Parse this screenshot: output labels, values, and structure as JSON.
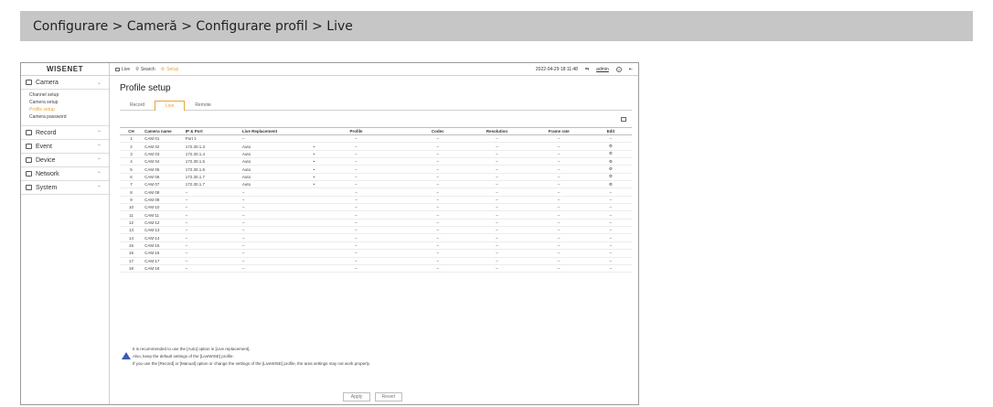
{
  "breadcrumb": "Configurare > Cameră > Configurare profil > Live",
  "topbar": {
    "logo": "WISENET",
    "nav": [
      {
        "label": "Live",
        "icon": "monitor-icon"
      },
      {
        "label": "Search",
        "icon": "search-icon"
      },
      {
        "label": "Setup",
        "icon": "gear-icon"
      }
    ],
    "datetime": "2022-04-29 18:11:48",
    "user": "admin",
    "icons": [
      "network-icon",
      "help-icon",
      "logout-icon"
    ]
  },
  "sidebar": {
    "camera_label": "Camera",
    "camera_items": [
      "Channel setup",
      "Camera setup",
      "Profile setup",
      "Camera password"
    ],
    "active_item": "Profile setup",
    "sections": [
      "Record",
      "Event",
      "Device",
      "Network",
      "System"
    ]
  },
  "main": {
    "title": "Profile setup",
    "tabs": [
      "Record",
      "Live",
      "Remote"
    ],
    "active_tab": "Live",
    "columns": [
      "CH",
      "Camera name",
      "IP & Port",
      "Live Replacement",
      "",
      "Profile",
      "",
      "Codec",
      "Resolution",
      "Frame rate",
      "Edit"
    ],
    "rows": [
      [
        "1",
        "CAM 01",
        "Port 1",
        "–",
        "",
        "–",
        "",
        "–",
        "–",
        "–",
        "–"
      ],
      [
        "2",
        "CAM 02",
        "172.30.1.3",
        "Auto",
        "•",
        "–",
        "",
        "–",
        "–",
        "–",
        "⚙"
      ],
      [
        "3",
        "CAM 03",
        "172.30.1.4",
        "Auto",
        "•",
        "–",
        "",
        "–",
        "–",
        "–",
        "⚙"
      ],
      [
        "4",
        "CAM 04",
        "172.30.1.5",
        "Auto",
        "•",
        "–",
        "",
        "–",
        "–",
        "–",
        "⚙"
      ],
      [
        "5",
        "CAM 05",
        "172.30.1.6",
        "Auto",
        "•",
        "–",
        "",
        "–",
        "–",
        "–",
        "⚙"
      ],
      [
        "6",
        "CAM 06",
        "172.30.1.7",
        "Auto",
        "•",
        "–",
        "",
        "–",
        "–",
        "–",
        "⚙"
      ],
      [
        "7",
        "CAM 07",
        "172.30.1.7",
        "Auto",
        "•",
        "–",
        "",
        "–",
        "–",
        "–",
        "⚙"
      ],
      [
        "8",
        "CAM 08",
        "–",
        "–",
        "",
        "–",
        "",
        "–",
        "–",
        "–",
        "–"
      ],
      [
        "9",
        "CAM 09",
        "–",
        "–",
        "",
        "–",
        "",
        "–",
        "–",
        "–",
        "–"
      ],
      [
        "10",
        "CAM 10",
        "–",
        "–",
        "",
        "–",
        "",
        "–",
        "–",
        "–",
        "–"
      ],
      [
        "11",
        "CAM 11",
        "–",
        "–",
        "",
        "–",
        "",
        "–",
        "–",
        "–",
        "–"
      ],
      [
        "12",
        "CAM 12",
        "–",
        "–",
        "",
        "–",
        "",
        "–",
        "–",
        "–",
        "–"
      ],
      [
        "13",
        "CAM 13",
        "–",
        "–",
        "",
        "–",
        "",
        "–",
        "–",
        "–",
        "–"
      ],
      [
        "14",
        "CAM 14",
        "–",
        "–",
        "",
        "–",
        "",
        "–",
        "–",
        "–",
        "–"
      ],
      [
        "15",
        "CAM 15",
        "–",
        "–",
        "",
        "–",
        "",
        "–",
        "–",
        "–",
        "–"
      ],
      [
        "16",
        "CAM 16",
        "–",
        "–",
        "",
        "–",
        "",
        "–",
        "–",
        "–",
        "–"
      ],
      [
        "17",
        "CAM 17",
        "–",
        "–",
        "",
        "–",
        "",
        "–",
        "–",
        "–",
        "–"
      ],
      [
        "18",
        "CAM 18",
        "–",
        "–",
        "",
        "–",
        "",
        "–",
        "–",
        "–",
        "–"
      ]
    ],
    "notes": [
      "It is recommended to use the [Auto] option in [Live replacement].",
      "Also, keep the default settings of the [LiveWISE] profile.",
      "If you use the [Record] or [Manual] option or change the settings of the [LiveWISE] profile, the area settings may not work properly."
    ],
    "apply_label": "Apply",
    "revert_label": "Revert"
  },
  "colors": {
    "accent": "#e8a33a",
    "warning": "#3b5bb1",
    "breadcrumb_bg": "#c6c6c6"
  }
}
